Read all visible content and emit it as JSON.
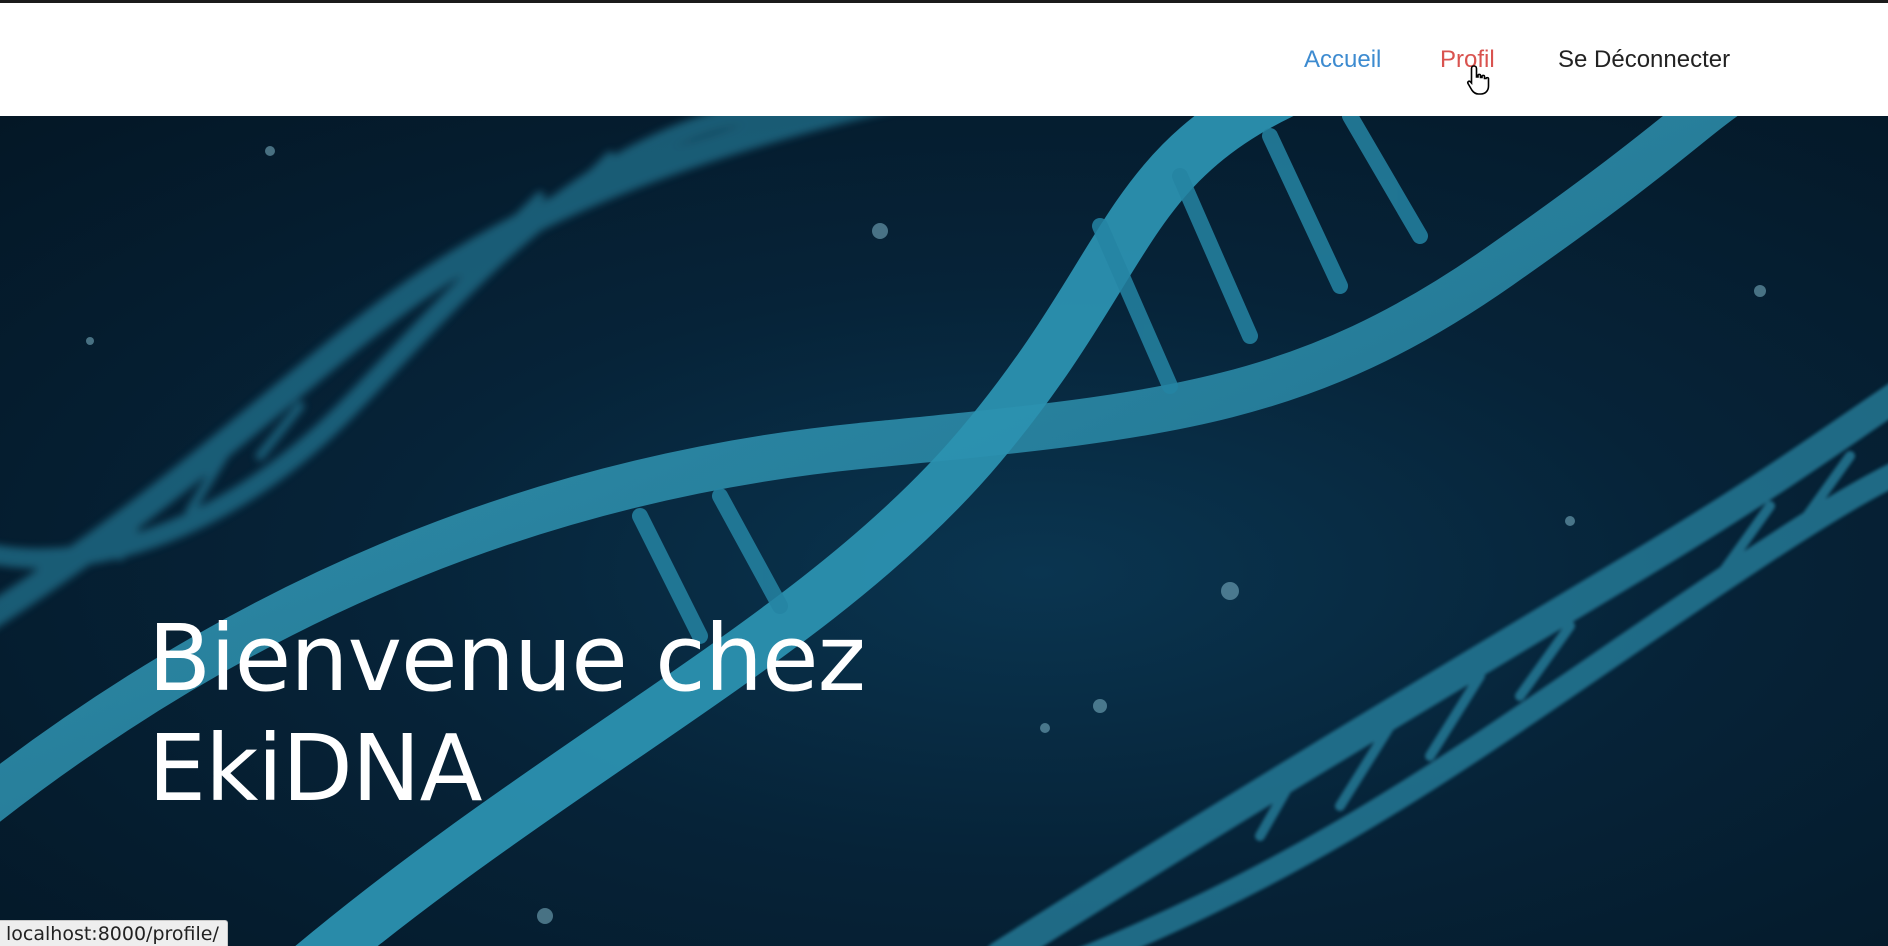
{
  "nav": {
    "items": [
      {
        "label": "Accueil",
        "color": "#3d8bd0"
      },
      {
        "label": "Profil",
        "color": "#d9534f"
      },
      {
        "label": "Se Déconnecter",
        "color": "#222222"
      }
    ]
  },
  "hero": {
    "title_line1": "Bienvenue chez",
    "title_line2": "EkiDNA",
    "background_icon": "dna-helix-image",
    "accent": "#2a8aa8"
  },
  "status_bar": {
    "url": "localhost:8000/profile/"
  }
}
